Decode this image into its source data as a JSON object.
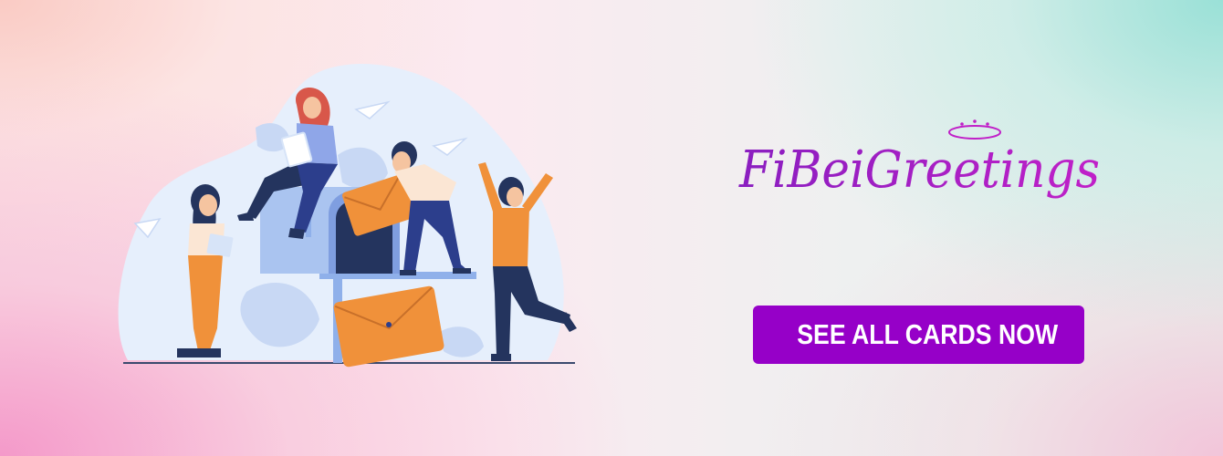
{
  "brand": {
    "name": "FiBeiGreetings",
    "color": "#a020c0"
  },
  "cta": {
    "label": "SEE ALL CARDS NOW",
    "background": "#9600c8",
    "text_color": "#ffffff"
  },
  "illustration": {
    "description_icon": "people-with-mailbox-illustration",
    "accent_colors": [
      "#f0913a",
      "#2c3e8c",
      "#aac4f0",
      "#e8f0fc"
    ]
  }
}
